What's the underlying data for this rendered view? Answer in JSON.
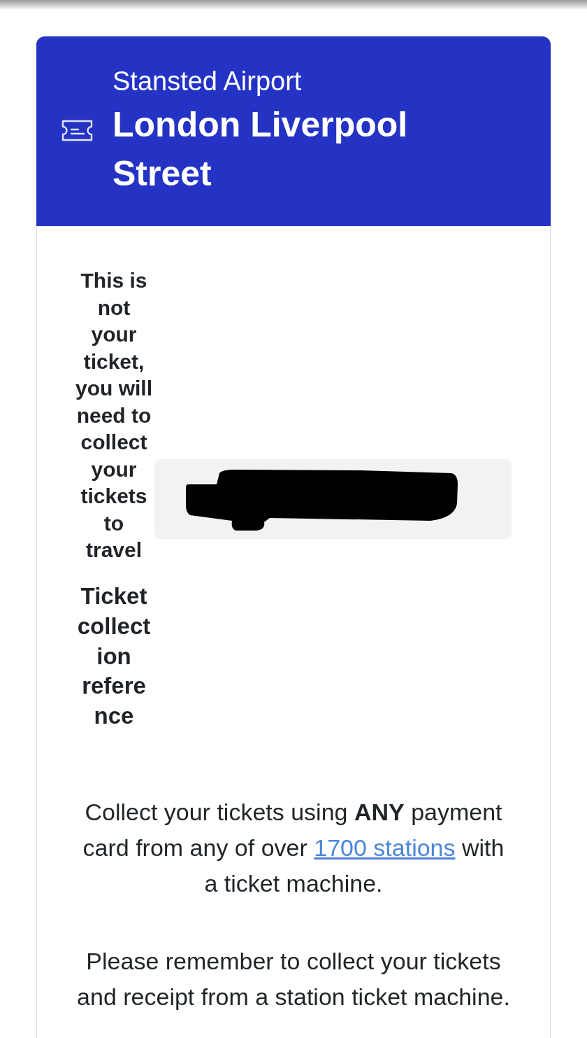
{
  "journey": {
    "origin": "Stansted Airport",
    "destination": "London Liverpool Street"
  },
  "notice": "This is not your ticket, you will need to collect your tickets to travel",
  "reference": {
    "label": "Ticket collection reference"
  },
  "instructions": [
    {
      "segments": [
        {
          "kind": "text",
          "text": "Collect your tickets using **ANY** payment card from any of over"
        },
        {
          "kind": "link",
          "text": "1700 stations"
        },
        {
          "kind": "text",
          "text": "with a ticket machine."
        }
      ]
    },
    {
      "segments": [
        {
          "kind": "text",
          "text": "Please remember to collect your tickets and receipt from a station ticket machine."
        }
      ]
    }
  ]
}
